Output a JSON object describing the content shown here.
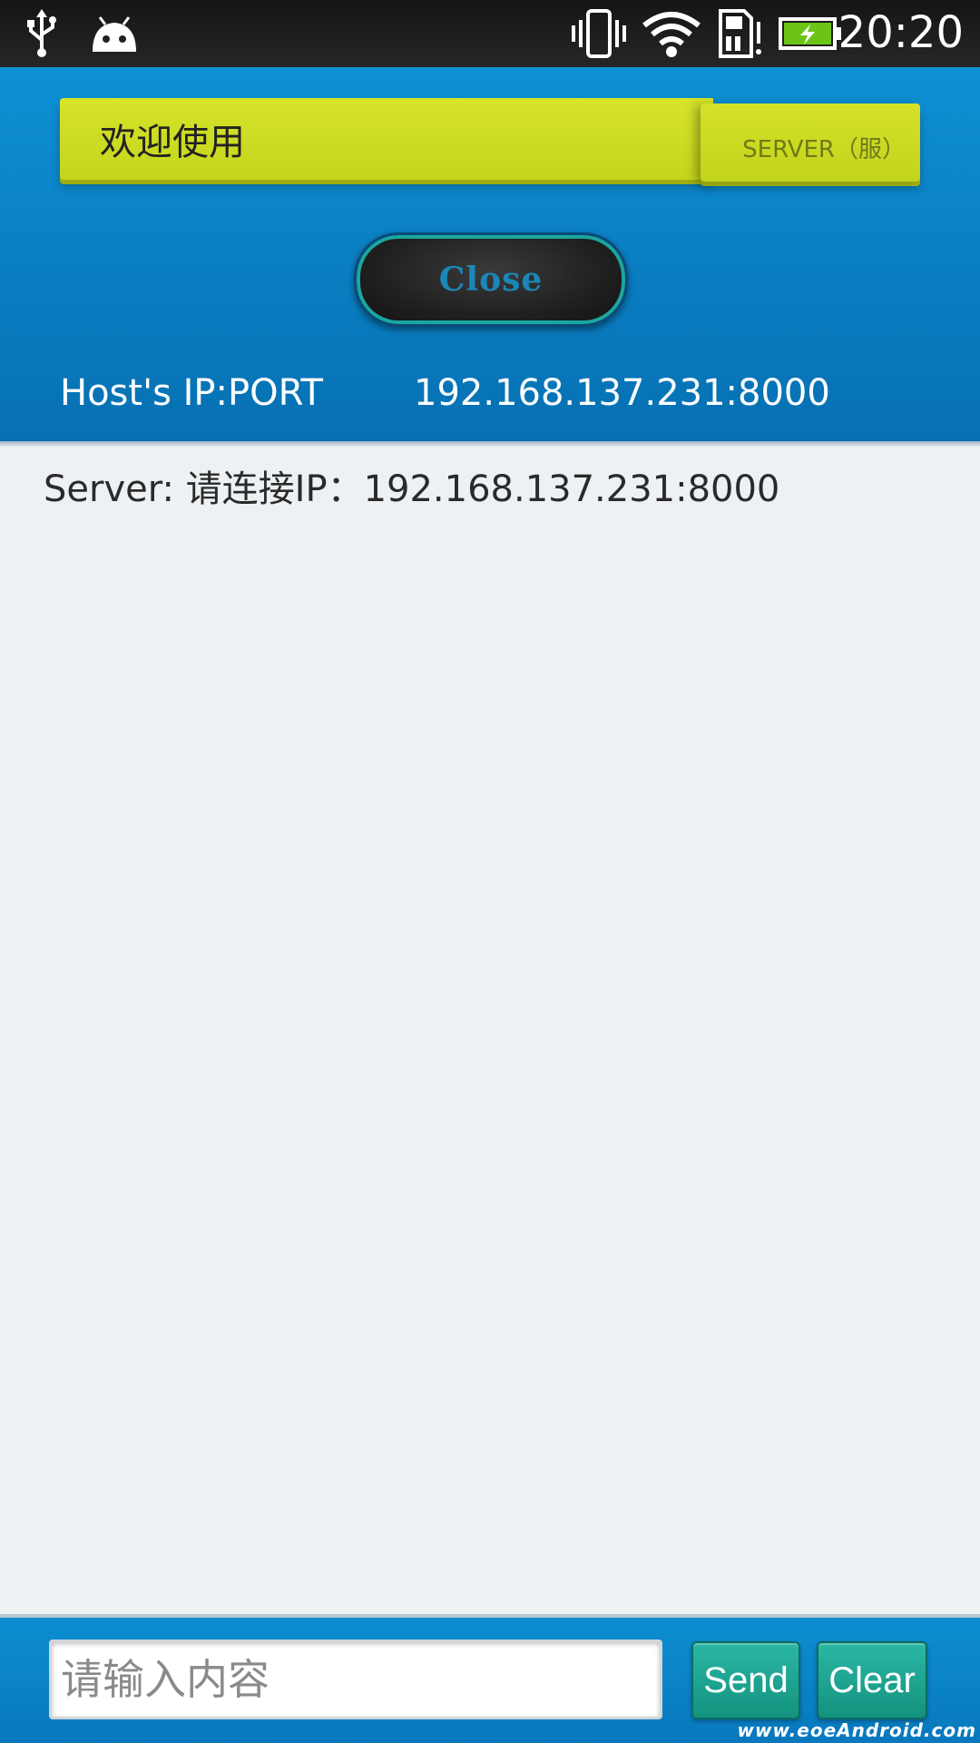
{
  "status_bar": {
    "time": "20:20",
    "icons": [
      "usb-icon",
      "android-debug-icon",
      "vibrate-icon",
      "wifi-icon",
      "sd-card-icon",
      "battery-charging-icon"
    ],
    "battery_color": "#6cc417"
  },
  "header": {
    "title": "欢迎使用",
    "mode_tab": "SERVER（服）",
    "close_label": "Close",
    "host_label": "Host's IP:PORT",
    "host_value": "192.168.137.231:8000"
  },
  "messages": [
    "Server: 请连接IP：192.168.137.231:8000"
  ],
  "input": {
    "placeholder": "请输入内容",
    "value": ""
  },
  "buttons": {
    "send": "Send",
    "clear": "Clear"
  },
  "watermark": "www.eoeAndroid.com",
  "colors": {
    "header_blue": "#0a7ec2",
    "title_bar": "#c8d820",
    "action_button": "#1aa390",
    "background": "#eef1f4"
  }
}
